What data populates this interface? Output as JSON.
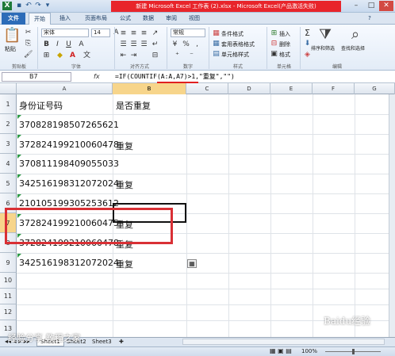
{
  "window": {
    "title": "新建 Microsoft Excel 工作表 (2).xlsx - Microsoft Excel(产品激活失败)"
  },
  "tabs": [
    "文件",
    "开始",
    "插入",
    "页面布局",
    "公式",
    "数据",
    "审阅",
    "视图"
  ],
  "ribbon": {
    "clipboard": {
      "paste": "粘贴",
      "label": "剪贴板"
    },
    "font": {
      "name": "宋体",
      "size": "14",
      "bold": "B",
      "italic": "I",
      "underline": "U",
      "label": "字体"
    },
    "alignment": {
      "label": "对齐方式"
    },
    "number": {
      "format": "常规",
      "percent": "%",
      "comma": ",",
      "label": "数字"
    },
    "styles": {
      "conditional": "条件格式",
      "table": "套用表格格式",
      "cell": "单元格样式",
      "label": "样式"
    },
    "cells": {
      "insert": "插入",
      "delete": "删除",
      "format": "格式",
      "label": "单元格"
    },
    "editing": {
      "sort": "排序和筛选",
      "find": "查找和选择",
      "label": "编辑"
    }
  },
  "formula_bar": {
    "name_box": "B7",
    "fx": "fx",
    "formula": "=IF(COUNTIF(A:A,A7)>1,\"重复\",\"\")"
  },
  "columns": [
    "A",
    "B",
    "C",
    "D",
    "E",
    "F",
    "G"
  ],
  "rows": [
    "1",
    "2",
    "3",
    "4",
    "5",
    "6",
    "7",
    "8",
    "9",
    "10",
    "11",
    "12",
    "13"
  ],
  "cells": {
    "a1": "身份证号码",
    "b1": "是否重复",
    "a2": "370828198507265621",
    "a3": "372824199210060478",
    "b3": "重复",
    "a4": "370811198409055033",
    "a5": "342516198312072024",
    "b5": "重复",
    "a6": "210105199305253612",
    "a7": "372824199210060475",
    "b7": "重复",
    "a8": "372824199210060478",
    "b8": "重复",
    "a9": "342516198312072024",
    "b9": "重复"
  },
  "sheets": [
    "Sheet1",
    "Sheet2",
    "Sheet3"
  ],
  "status": {
    "zoom": "100%"
  },
  "watermark": {
    "left": "经验分享 教程之家",
    "right": "Baidu经验"
  },
  "colors": {
    "accent_red": "#d93035",
    "file_tab": "#2c6cb8",
    "title_red": "#e8252b"
  }
}
